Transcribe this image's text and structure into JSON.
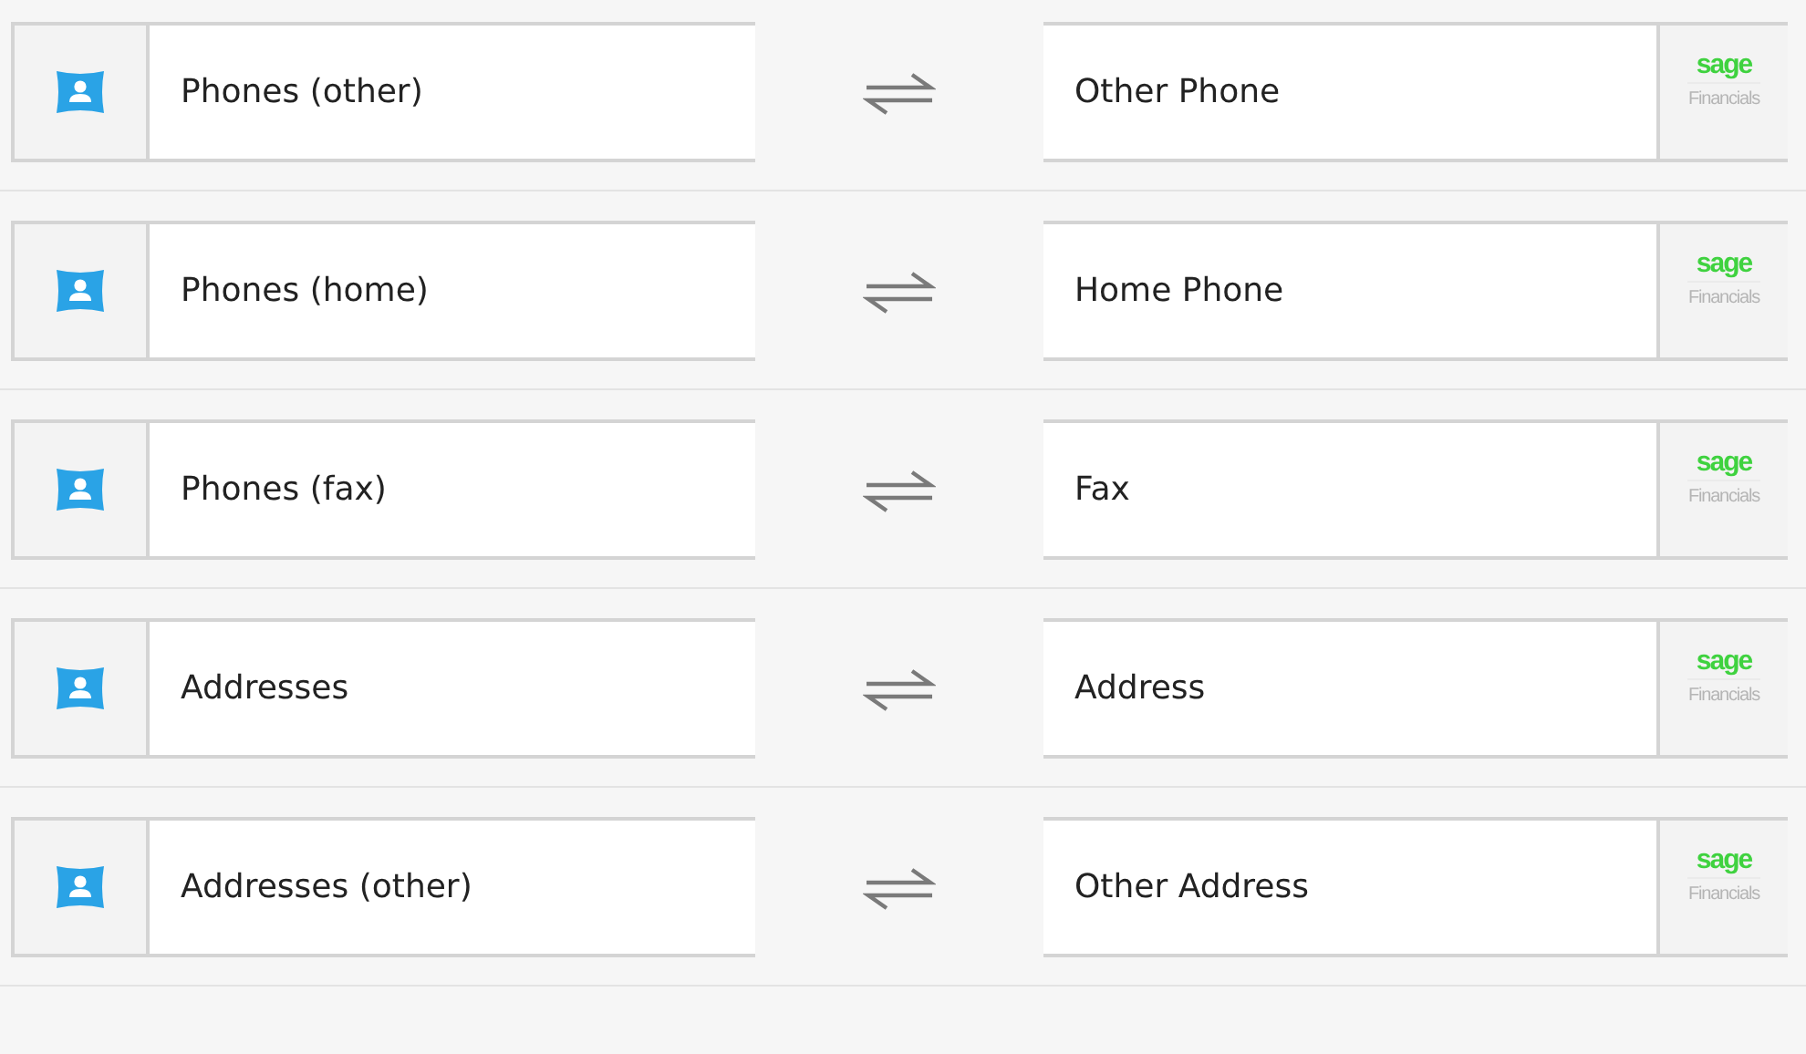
{
  "mappings": [
    {
      "source": "Phones (other)",
      "target": "Other Phone",
      "logo": {
        "name": "sage",
        "product": "Financials"
      }
    },
    {
      "source": "Phones (home)",
      "target": "Home Phone",
      "logo": {
        "name": "sage",
        "product": "Financials"
      }
    },
    {
      "source": "Phones (fax)",
      "target": "Fax",
      "logo": {
        "name": "sage",
        "product": "Financials"
      }
    },
    {
      "source": "Addresses",
      "target": "Address",
      "logo": {
        "name": "sage",
        "product": "Financials"
      }
    },
    {
      "source": "Addresses (other)",
      "target": "Other Address",
      "logo": {
        "name": "sage",
        "product": "Financials"
      }
    }
  ]
}
